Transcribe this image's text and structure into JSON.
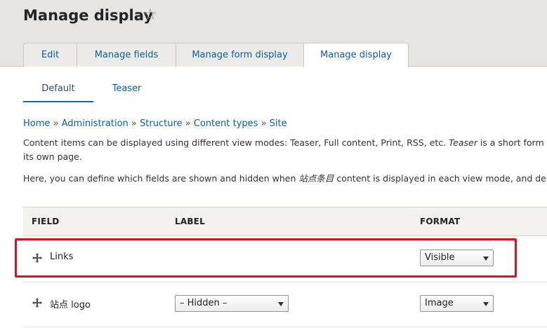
{
  "header": {
    "title": "Manage display",
    "tabs": [
      {
        "label": "Edit"
      },
      {
        "label": "Manage fields"
      },
      {
        "label": "Manage form display"
      },
      {
        "label": "Manage display"
      }
    ]
  },
  "subtabs": [
    {
      "label": "Default"
    },
    {
      "label": "Teaser"
    }
  ],
  "breadcrumb": [
    {
      "label": "Home"
    },
    {
      "label": "Administration"
    },
    {
      "label": "Structure"
    },
    {
      "label": "Content types"
    },
    {
      "label": "Site"
    }
  ],
  "breadcrumb_separator": "»",
  "description": {
    "line1_a": "Content items can be displayed using different view modes: Teaser, Full content, Print, RSS, etc. ",
    "line1_em": "Teaser",
    "line1_b": " is a short form",
    "line2": "its own page.",
    "line3_a": "Here, you can define which fields are shown and hidden when ",
    "line3_em": "站点条目",
    "line3_b": " content is displayed in each view mode, and de"
  },
  "table": {
    "headers": {
      "field": "FIELD",
      "label": "LABEL",
      "format": "FORMAT"
    },
    "rows": [
      {
        "field": "Links",
        "label_select": "",
        "format_select": "Visible"
      },
      {
        "field": "站点 logo",
        "label_select": "– Hidden –",
        "format_select": "Image"
      }
    ]
  },
  "colors": {
    "link": "#0b5ea6",
    "highlight": "#e0101a",
    "header_bg": "#e6e5e1"
  }
}
